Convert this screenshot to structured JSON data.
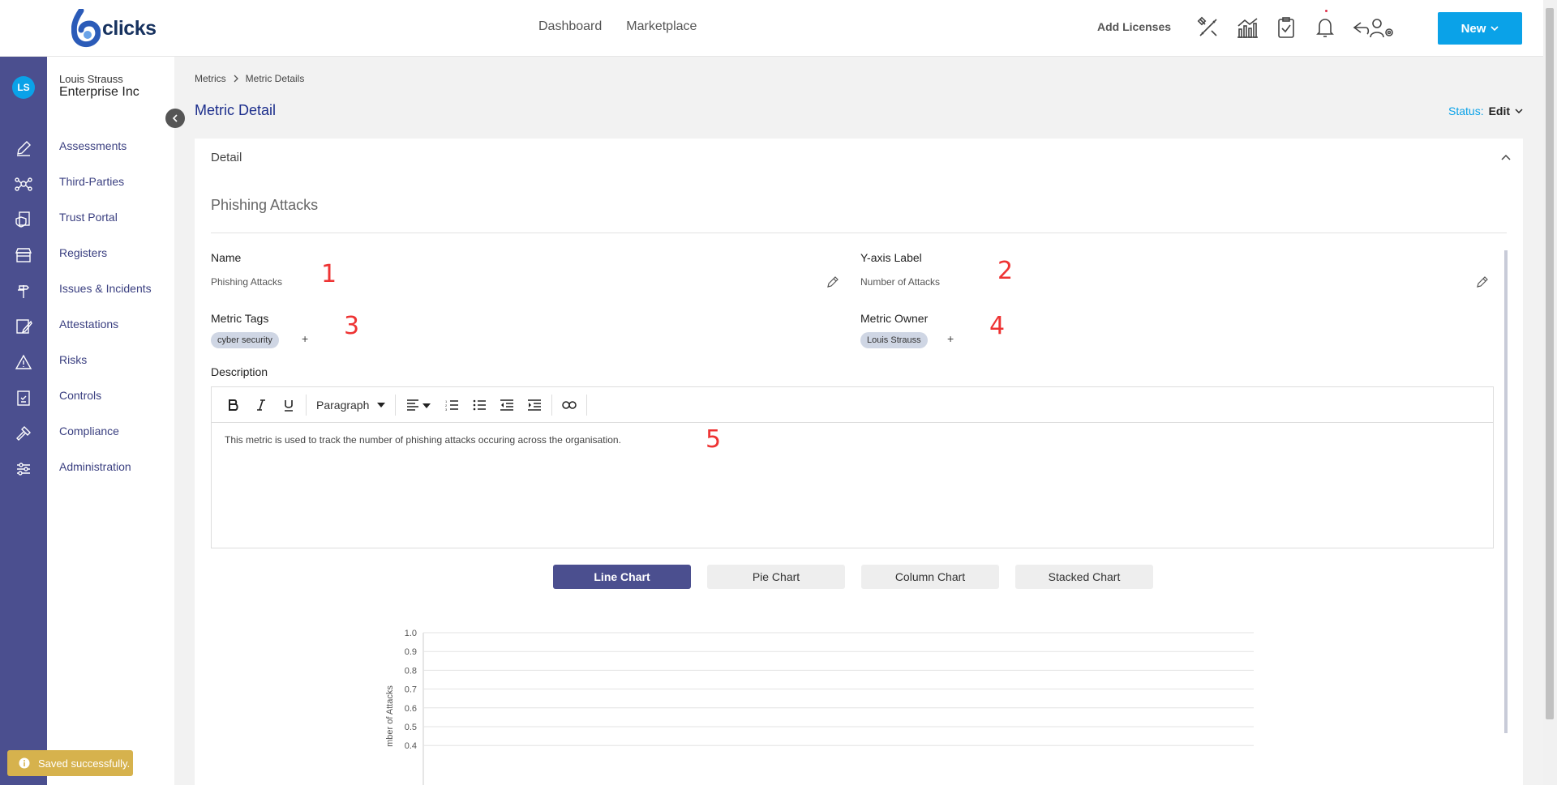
{
  "header": {
    "logo_text": "clicks",
    "nav": [
      {
        "label": "Dashboard"
      },
      {
        "label": "Marketplace"
      }
    ],
    "add_licenses": "Add Licenses",
    "new_button": "New"
  },
  "rail": {
    "avatar_initials": "LS"
  },
  "sidebar": {
    "user_name": "Louis Strauss",
    "org_name": "Enterprise Inc",
    "items": [
      {
        "label": "Assessments",
        "icon": "edit-icon"
      },
      {
        "label": "Third-Parties",
        "icon": "network-icon"
      },
      {
        "label": "Trust Portal",
        "icon": "document-shield-icon"
      },
      {
        "label": "Registers",
        "icon": "store-icon"
      },
      {
        "label": "Issues & Incidents",
        "icon": "signpost-icon"
      },
      {
        "label": "Attestations",
        "icon": "sign-icon"
      },
      {
        "label": "Risks",
        "icon": "warning-icon"
      },
      {
        "label": "Controls",
        "icon": "clipboard-check-icon"
      },
      {
        "label": "Compliance",
        "icon": "gavel-icon"
      },
      {
        "label": "Administration",
        "icon": "sliders-icon"
      }
    ]
  },
  "breadcrumb": {
    "parent": "Metrics",
    "current": "Metric Details"
  },
  "page": {
    "title": "Metric Detail",
    "status_label": "Status:",
    "status_value": "Edit"
  },
  "detail": {
    "section_title": "Detail",
    "metric_name": "Phishing Attacks",
    "name_label": "Name",
    "name_value": "Phishing Attacks",
    "yaxis_label": "Y-axis Label",
    "yaxis_value": "Number of Attacks",
    "tags_label": "Metric Tags",
    "tags": [
      "cyber security"
    ],
    "owner_label": "Metric Owner",
    "owners": [
      "Louis Strauss"
    ],
    "add_symbol": "+",
    "description_label": "Description",
    "paragraph_style": "Paragraph",
    "description_text": "This metric is used to track the number of phishing attacks occuring across the organisation."
  },
  "annotations": [
    "1",
    "2",
    "3",
    "4",
    "5"
  ],
  "chart_tabs": [
    {
      "label": "Line Chart",
      "active": true
    },
    {
      "label": "Pie Chart",
      "active": false
    },
    {
      "label": "Column Chart",
      "active": false
    },
    {
      "label": "Stacked Chart",
      "active": false
    }
  ],
  "chart_data": {
    "type": "line",
    "series": [],
    "ylabel": "mber of Attacks",
    "ylim": [
      0.4,
      1.0
    ],
    "yticks": [
      "1.0",
      "0.9",
      "0.8",
      "0.7",
      "0.6",
      "0.5",
      "0.4"
    ],
    "grid": true
  },
  "toast": {
    "message": "Saved successfully."
  },
  "colors": {
    "accent": "#0aa2e8",
    "rail": "#4b4f8f",
    "title": "#1c2e8c",
    "toast": "#d6b24d",
    "annotation": "#ee3333"
  }
}
